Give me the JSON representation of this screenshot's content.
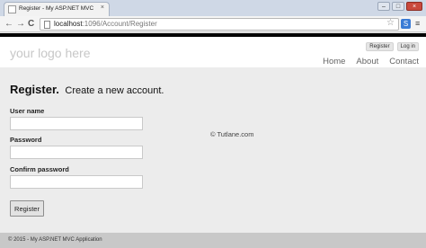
{
  "browser": {
    "tab_title": "Register - My ASP.NET MVC",
    "tab_close": "×",
    "window_controls": [
      "–",
      "□",
      "×"
    ],
    "nav_back": "←",
    "nav_forward": "→",
    "nav_reload": "C",
    "url_host": "localhost",
    "url_rest": ":1096/Account/Register",
    "star_icon": "☆",
    "menu_icon": "≡"
  },
  "site": {
    "logo": "your logo here",
    "login_links": [
      "Register",
      "Log in"
    ],
    "menu": [
      "Home",
      "About",
      "Contact"
    ]
  },
  "form": {
    "heading_bold": "Register.",
    "heading_sub": "Create a new account.",
    "fields": [
      {
        "label": "User name",
        "value": ""
      },
      {
        "label": "Password",
        "value": ""
      },
      {
        "label": "Confirm password",
        "value": ""
      }
    ],
    "submit_label": "Register"
  },
  "watermark": "© Tutlane.com",
  "footer": {
    "text": "© 2015 - My ASP.NET MVC Application"
  }
}
